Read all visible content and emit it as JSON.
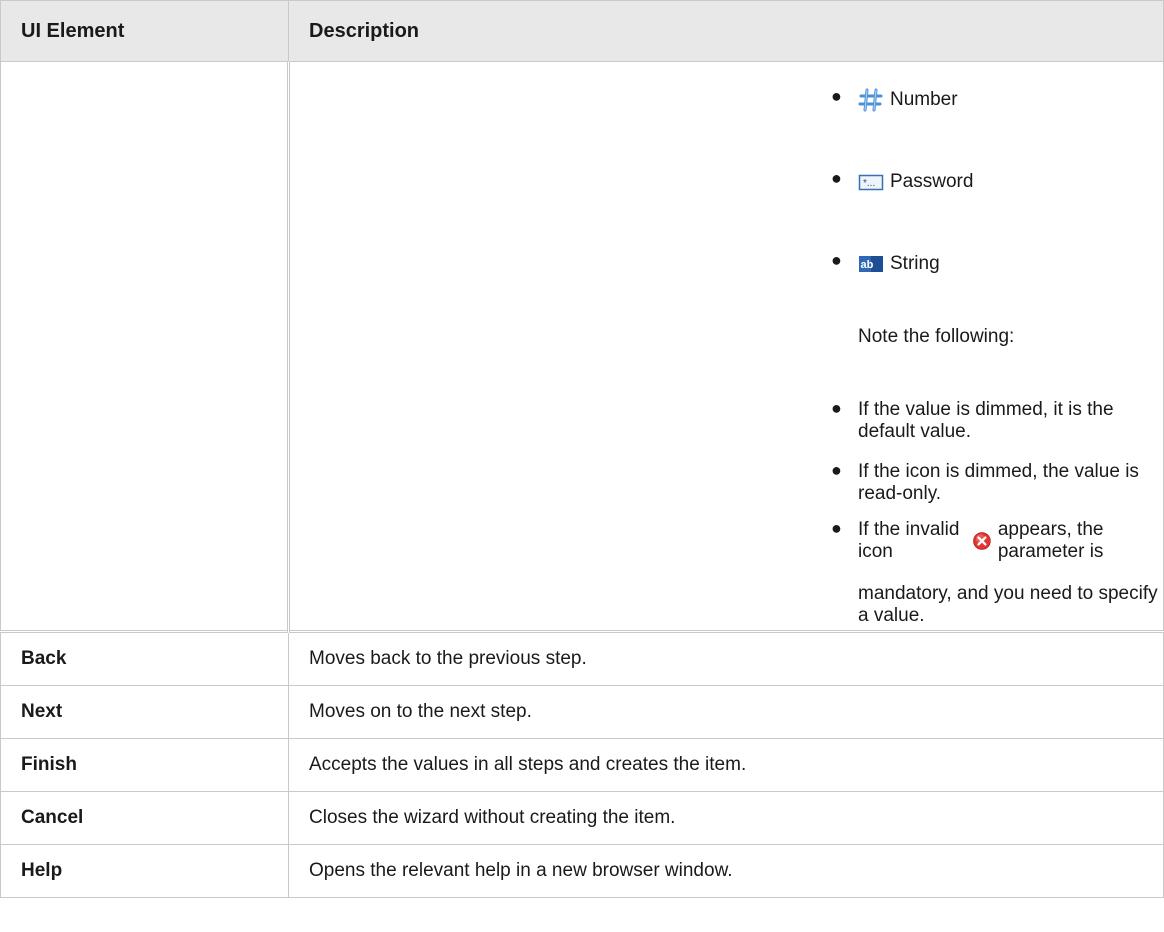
{
  "header": {
    "col1": "UI Element",
    "col2": "Description"
  },
  "types": [
    {
      "icon": "number-icon",
      "label": "Number"
    },
    {
      "icon": "password-icon",
      "label": "Password"
    },
    {
      "icon": "string-icon",
      "label": "String"
    }
  ],
  "note_intro": "Note the following:",
  "notes": {
    "n1": "If the value is dimmed, it is the default value.",
    "n2": "If the icon is dimmed, the value is read-only.",
    "n3_before": "If the invalid icon",
    "n3_after": "appears, the parameter is",
    "n3_line2": "mandatory, and you need to specify a value."
  },
  "rows": [
    {
      "element": "Back",
      "description": "Moves back to the previous step."
    },
    {
      "element": "Next",
      "description": "Moves on to the next step."
    },
    {
      "element": "Finish",
      "description": "Accepts the values in all steps and creates the item."
    },
    {
      "element": "Cancel",
      "description": "Closes the wizard without creating the item."
    },
    {
      "element": "Help",
      "description": "Opens the relevant help in a new browser window."
    }
  ],
  "colors": {
    "header_bg": "#e8e8e8",
    "border": "#c9c9c9",
    "invalid_red": "#e2352f"
  }
}
